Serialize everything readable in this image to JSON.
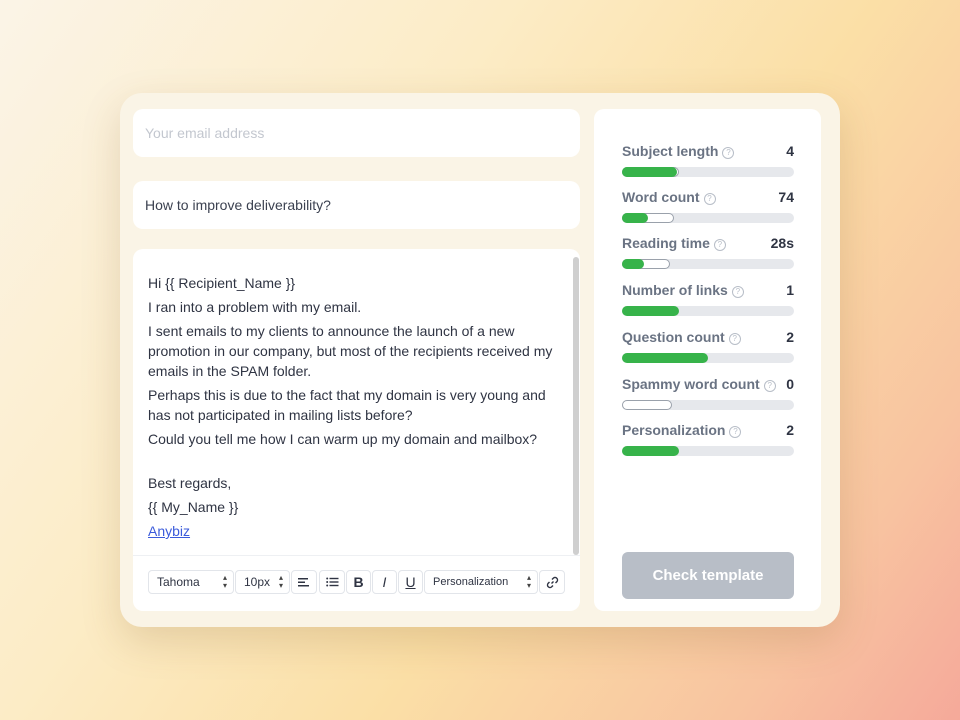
{
  "email_field": {
    "placeholder": "Your email address",
    "value": ""
  },
  "subject": "How to improve deliverability?",
  "body": {
    "greeting": "Hi {{ Recipient_Name }}",
    "line1": "I ran into a problem with my email.",
    "line2": "I sent emails to my clients to announce the launch of a new promotion in our company, but most of the recipients received my emails in the SPAM folder.",
    "line3": "Perhaps this is due to the fact that my domain is very young and has not participated in mailing lists before?",
    "line4": "Could you tell me how I can warm up my domain and mailbox?",
    "signoff": "Best regards,",
    "name": "{{ My_Name }}",
    "link": "Anybiz"
  },
  "toolbar": {
    "font": "Tahoma",
    "size": "10px",
    "personalization": "Personalization",
    "bold": "B",
    "italic": "I",
    "underline": "U"
  },
  "metrics": [
    {
      "label": "Subject length",
      "value": "4",
      "progress": 0.32,
      "knob": 0.33
    },
    {
      "label": "Word count",
      "value": "74",
      "progress": 0.15,
      "knob": 0.3
    },
    {
      "label": "Reading time",
      "value": "28s",
      "progress": 0.13,
      "knob": 0.28
    },
    {
      "label": "Number of links",
      "value": "1",
      "progress": 0.33,
      "knob": 0
    },
    {
      "label": "Question count",
      "value": "2",
      "progress": 0.5,
      "knob": 0
    },
    {
      "label": "Spammy word count",
      "value": "0",
      "progress": 0,
      "knob": 0.29
    },
    {
      "label": "Personalization",
      "value": "2",
      "progress": 0.33,
      "knob": 0
    }
  ],
  "check_button": "Check template",
  "colors": {
    "accent_green": "#37b34a",
    "button_disabled": "#b8bec7",
    "link": "#3b5bdb",
    "card_bg": "#faf4e6"
  },
  "icons": {
    "help": "question-circle-icon",
    "align": "align-left-icon",
    "list": "bullet-list-icon",
    "link": "link-icon"
  }
}
